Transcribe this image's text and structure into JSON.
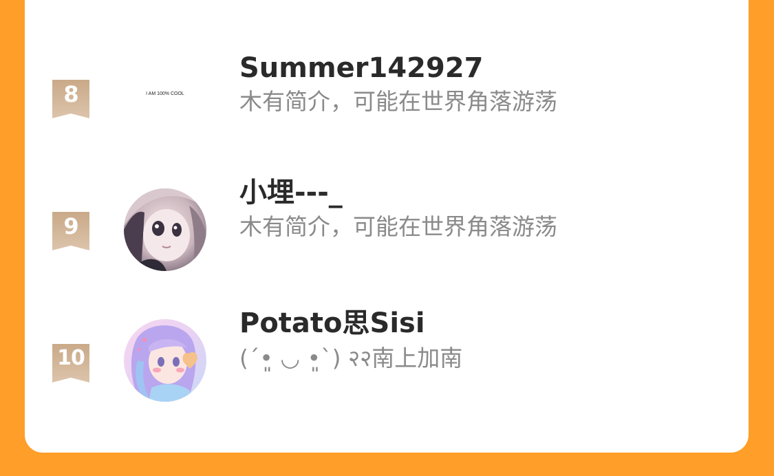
{
  "colors": {
    "background": "#FF9E28",
    "card": "#FFFFFF",
    "rank_badge": "#D1B597",
    "name_text": "#2A2A2A",
    "bio_text": "#8A8A8A"
  },
  "rankings": [
    {
      "rank": "8",
      "name": "Summer142927",
      "bio": "木有简介，可能在世界角落游荡",
      "avatar_text": "I AM 100% COOL"
    },
    {
      "rank": "9",
      "name": "小埋---_",
      "bio": "木有简介，可能在世界角落游荡",
      "avatar_text": ""
    },
    {
      "rank": "10",
      "name": "Potato思Sisi",
      "bio": "(ˊ•͈ ◡ •͈ˋ) २२南上加南",
      "avatar_text": ""
    }
  ]
}
